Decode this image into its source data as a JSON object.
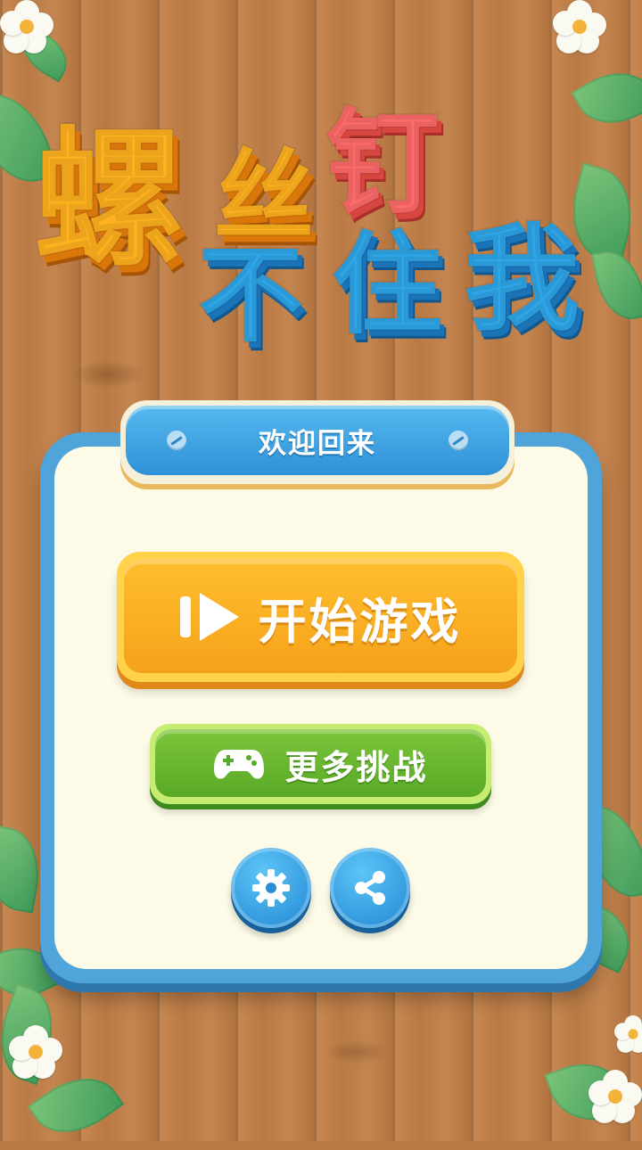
{
  "game": {
    "title_chars": [
      "螺",
      "丝",
      "钉",
      "不",
      "住",
      "我"
    ]
  },
  "panel": {
    "header": "欢迎回来"
  },
  "buttons": {
    "start": {
      "label": "开始游戏",
      "icon": "play-icon"
    },
    "more": {
      "label": "更多挑战",
      "icon": "gamepad-icon"
    },
    "settings": {
      "icon": "gear-icon"
    },
    "share": {
      "icon": "share-icon"
    }
  },
  "colors": {
    "title_orange": "#ffb21f",
    "title_red": "#ff6b6b",
    "title_blue": "#2fa6e9",
    "panel_blue": "#4fa4da",
    "start_button": "#f5a21b",
    "more_button": "#58a925",
    "round_button": "#2087d3"
  }
}
